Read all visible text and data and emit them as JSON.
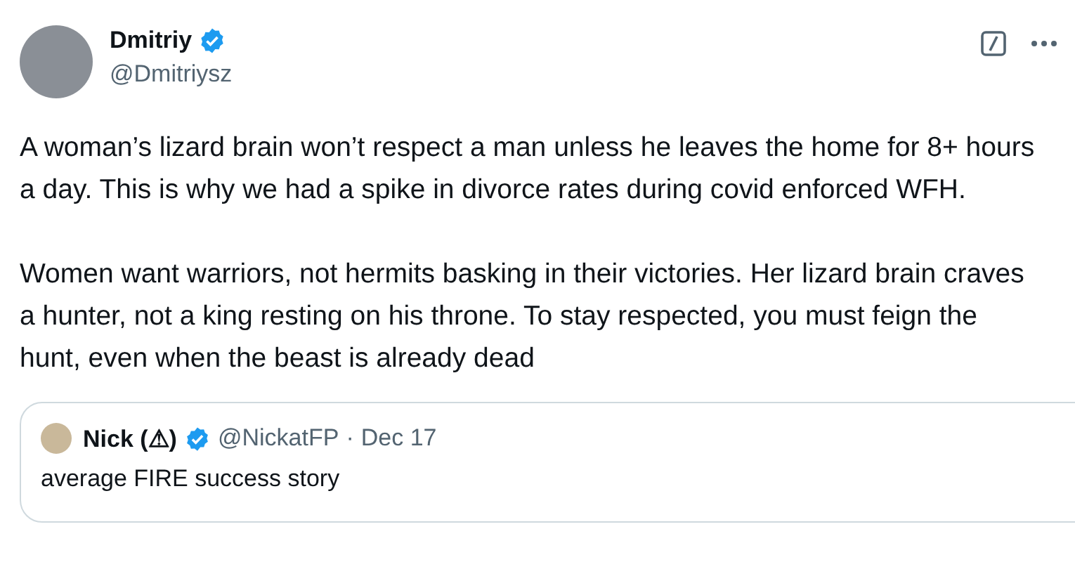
{
  "author": {
    "name": "Dmitriy",
    "verified": true,
    "handle": "@Dmitriysz"
  },
  "paragraphs": [
    "A woman’s lizard brain won’t respect a man unless he leaves the home for 8+ hours a day. This is why we had a spike in divorce rates during covid enforced WFH.",
    "Women want warriors, not hermits basking in their victories. Her lizard brain craves a hunter, not a king resting on his throne. To stay respected, you must feign the hunt, even when the beast is already dead"
  ],
  "quoted": {
    "name": "Nick (⚠)",
    "verified": true,
    "handle": "@NickatFP",
    "separator": "·",
    "date": "Dec 17",
    "text": "average FIRE success story"
  }
}
